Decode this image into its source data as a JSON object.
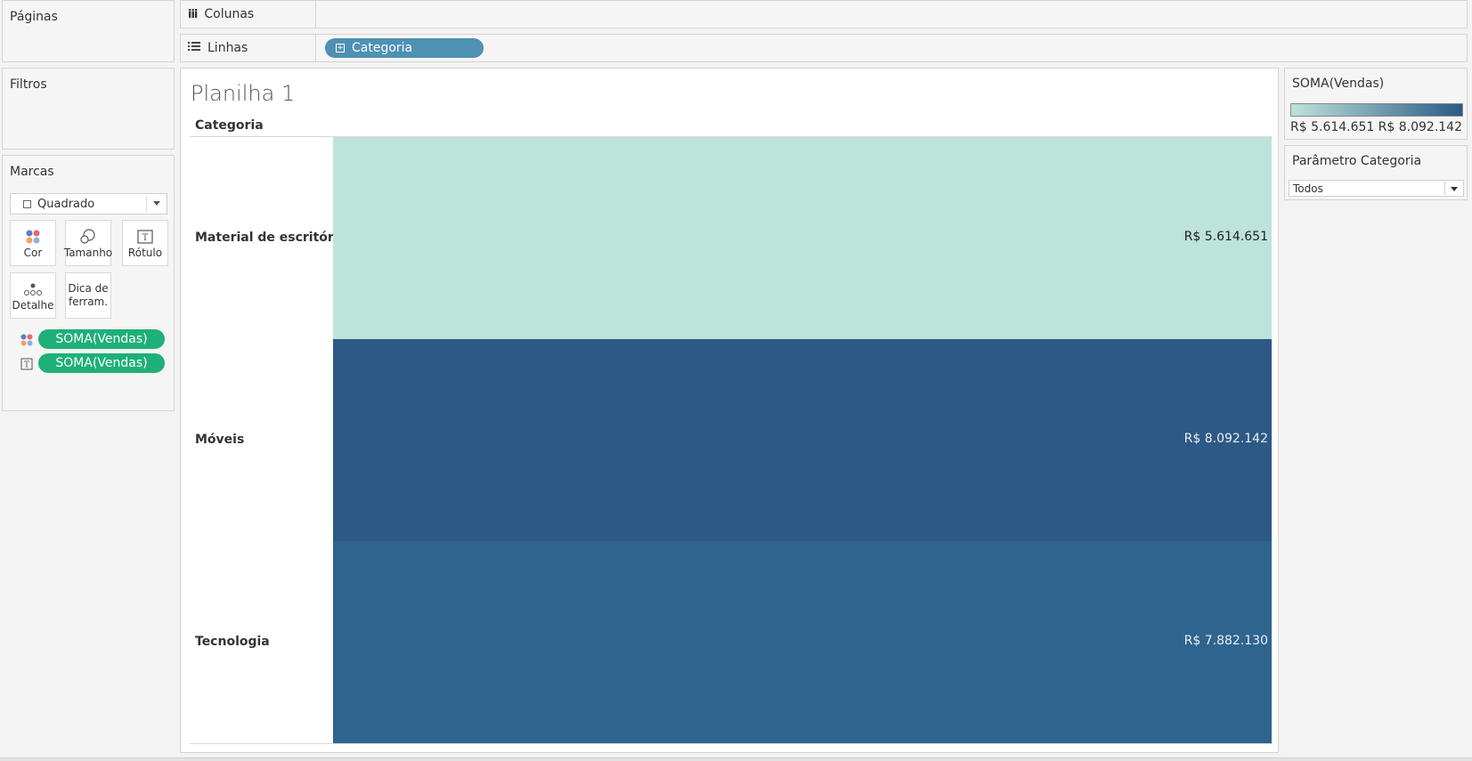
{
  "shelves": {
    "pages_title": "Páginas",
    "columns_label": "Colunas",
    "rows_label": "Linhas",
    "rows_pill": "Categoria"
  },
  "filters": {
    "title": "Filtros"
  },
  "marks": {
    "title": "Marcas",
    "mark_type": "Quadrado",
    "buttons": {
      "color": "Cor",
      "size": "Tamanho",
      "label": "Rótulo",
      "detail": "Detalhe",
      "tooltip": "Dica de ferram."
    },
    "pills": [
      "SOMA(Vendas)",
      "SOMA(Vendas)"
    ]
  },
  "sheet": {
    "title": "Planilha 1",
    "column_header": "Categoria",
    "rows": [
      {
        "category": "Material de escritório",
        "value": "R$ 5.614.651",
        "color": "#bde3da",
        "text_color": "#222222"
      },
      {
        "category": "Móveis",
        "value": "R$ 8.092.142",
        "color": "#2c5985",
        "text_color": "#e8eef5"
      },
      {
        "category": "Tecnologia",
        "value": "R$ 7.882.130",
        "color": "#2f648f",
        "text_color": "#e8eef5"
      }
    ]
  },
  "legend": {
    "title": "SOMA(Vendas)",
    "min": "R$ 5.614.651",
    "max": "R$ 8.092.142",
    "colors": {
      "low": "#bde3da",
      "high": "#2b5a85"
    }
  },
  "parameter": {
    "title": "Parâmetro Categoria",
    "value": "Todos"
  }
}
